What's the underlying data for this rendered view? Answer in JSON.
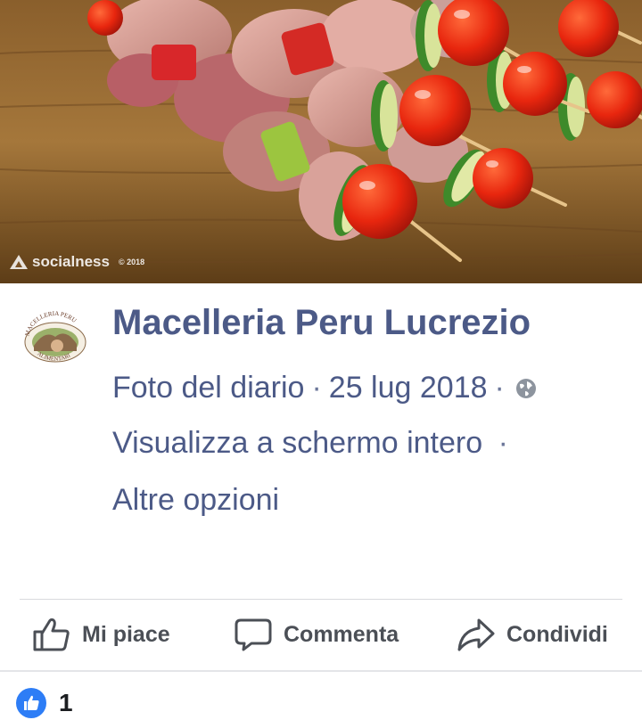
{
  "photo": {
    "description_icon": "food-photo",
    "watermark_brand": "socialness",
    "watermark_year": "© 2018"
  },
  "post": {
    "page_name": "Macelleria Peru Lucrezio",
    "meta_type": "Foto del diario",
    "meta_date": "25 lug 2018",
    "separator": "·",
    "view_fullscreen": "Visualizza a schermo intero",
    "more_options": "Altre opzioni",
    "avatar_top_text": "MACELLERIA PERU",
    "avatar_bottom_text": "ALIMENTARI"
  },
  "actions": {
    "like_label": "Mi piace",
    "comment_label": "Commenta",
    "share_label": "Condividi"
  },
  "reactions": {
    "count": "1"
  },
  "colors": {
    "link": "#4c5a87",
    "action_text": "#4b4f56",
    "like_blue": "#2d7df6"
  }
}
